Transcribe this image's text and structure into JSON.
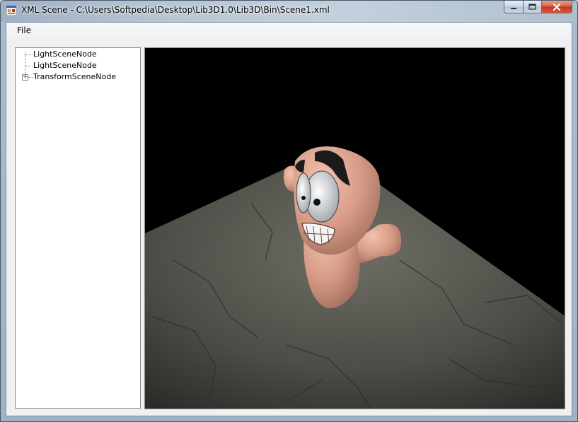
{
  "window": {
    "title": "XML Scene - C:\\Users\\Softpedia\\Desktop\\Lib3D1.0\\Lib3D\\Bin\\Scene1.xml"
  },
  "menu": {
    "file": "File"
  },
  "tree": {
    "items": [
      {
        "label": "LightSceneNode"
      },
      {
        "label": "LightSceneNode"
      },
      {
        "label": "TransformSceneNode",
        "expander": "+"
      }
    ]
  },
  "colors": {
    "viewport_bg": "#000000",
    "floor": "#575750",
    "skin": "#d9a089",
    "eyebrow": "#1b1b1b"
  }
}
